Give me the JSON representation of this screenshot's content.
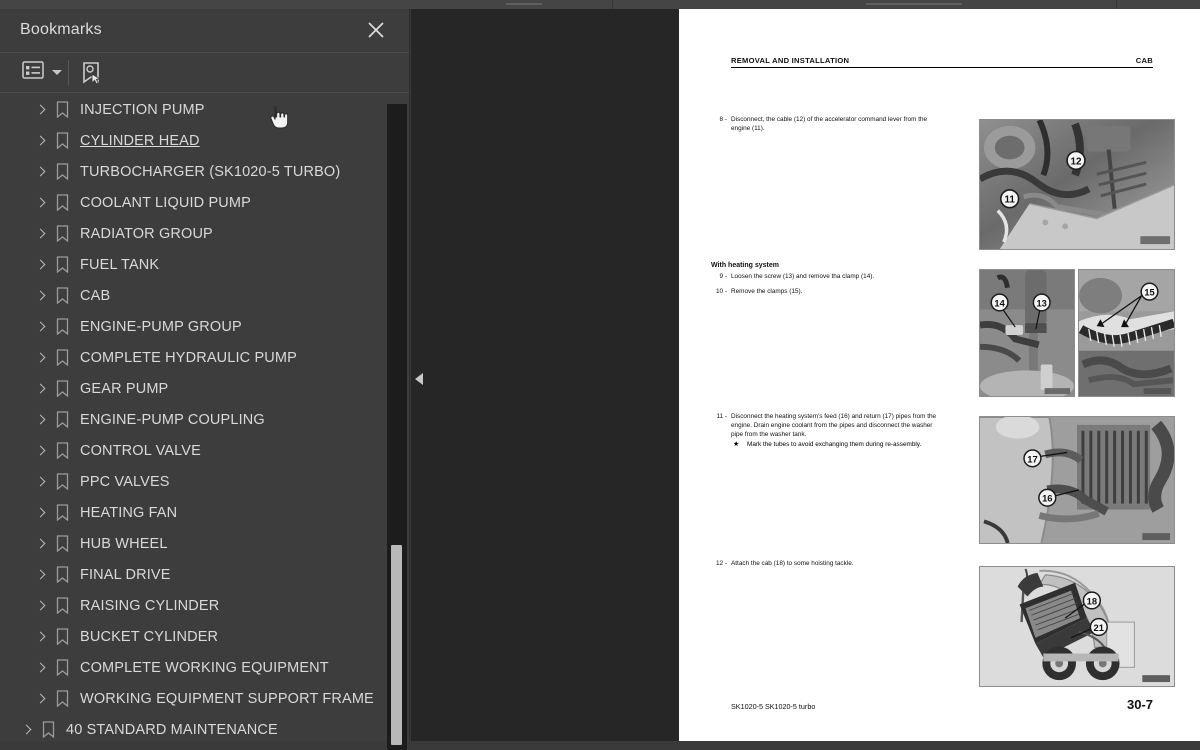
{
  "app": {
    "viewer_background": "#262626",
    "panel_background": "#3d3d3d"
  },
  "bookmarks_panel": {
    "title": "Bookmarks",
    "close_label": "×",
    "toolbar": {
      "list_options_icon": "list-options-icon",
      "dropdown_caret_icon": "chevron-down-icon",
      "new_bookmark_icon": "new-bookmark-icon"
    },
    "items": [
      {
        "label": "INJECTION PUMP",
        "level": 1,
        "state": "partial"
      },
      {
        "label": "CYLINDER HEAD",
        "level": 1,
        "state": "hover"
      },
      {
        "label": "TURBOCHARGER (SK1020-5 TURBO)",
        "level": 1,
        "state": "normal"
      },
      {
        "label": "COOLANT LIQUID PUMP",
        "level": 1,
        "state": "normal"
      },
      {
        "label": "RADIATOR GROUP",
        "level": 1,
        "state": "normal"
      },
      {
        "label": "FUEL TANK",
        "level": 1,
        "state": "normal"
      },
      {
        "label": "CAB",
        "level": 1,
        "state": "normal"
      },
      {
        "label": "ENGINE-PUMP GROUP",
        "level": 1,
        "state": "normal"
      },
      {
        "label": "COMPLETE HYDRAULIC PUMP",
        "level": 1,
        "state": "normal"
      },
      {
        "label": "GEAR PUMP",
        "level": 1,
        "state": "normal"
      },
      {
        "label": "ENGINE-PUMP COUPLING",
        "level": 1,
        "state": "normal"
      },
      {
        "label": "CONTROL VALVE",
        "level": 1,
        "state": "normal"
      },
      {
        "label": "PPC VALVES",
        "level": 1,
        "state": "normal"
      },
      {
        "label": "HEATING FAN",
        "level": 1,
        "state": "normal"
      },
      {
        "label": "HUB WHEEL",
        "level": 1,
        "state": "normal"
      },
      {
        "label": "FINAL DRIVE",
        "level": 1,
        "state": "normal"
      },
      {
        "label": "RAISING CYLINDER",
        "level": 1,
        "state": "normal"
      },
      {
        "label": "BUCKET CYLINDER",
        "level": 1,
        "state": "normal"
      },
      {
        "label": "COMPLETE WORKING EQUIPMENT",
        "level": 1,
        "state": "normal"
      },
      {
        "label": "WORKING EQUIPMENT SUPPORT FRAME",
        "level": 1,
        "state": "normal"
      },
      {
        "label": "40 STANDARD MAINTENANCE",
        "level": 0,
        "state": "normal"
      }
    ]
  },
  "viewer": {
    "collapse_handle_icon": "triangle-left-icon"
  },
  "document_page": {
    "header_left": "REMOVAL AND INSTALLATION",
    "header_right": "CAB",
    "footer_left": "SK1020-5  SK1020-5 turbo",
    "footer_right": "30-7",
    "step8": {
      "num": "8 -",
      "text": "Disconnect, the cable (12) of the accelerator command lever from the engine (11)."
    },
    "section_heading": "With heating system",
    "step9": {
      "num": "9 -",
      "text": "Loosen the screw (13) and remove tha clamp (14)."
    },
    "step10": {
      "num": "10 -",
      "text": "Remove the clamps (15)."
    },
    "step11": {
      "num": "11 -",
      "text": "Disconnect the heating system's feed (16) and return (17) pipes from the engine. Drain engine coolant from the pipes and disconnect the washer pipe from the washer tank.",
      "note_star": "★",
      "note": "Mark the tubes to avoid exchanging them during re-assembly."
    },
    "step12": {
      "num": "12 -",
      "text": "Attach the cab (18) to some hoisting tackle."
    },
    "figures": [
      {
        "name": "engine-accelerator-cable-photo",
        "callouts": [
          "11",
          "12"
        ]
      },
      {
        "name": "heating-clamp-photo-left",
        "callouts": [
          "14",
          "13"
        ]
      },
      {
        "name": "heating-clamps-photo-right",
        "callouts": [
          "15"
        ]
      },
      {
        "name": "heating-feed-return-pipes-photo",
        "callouts": [
          "17",
          "16"
        ]
      },
      {
        "name": "cab-hoisting-photo",
        "callouts": [
          "18",
          "21"
        ]
      }
    ]
  }
}
